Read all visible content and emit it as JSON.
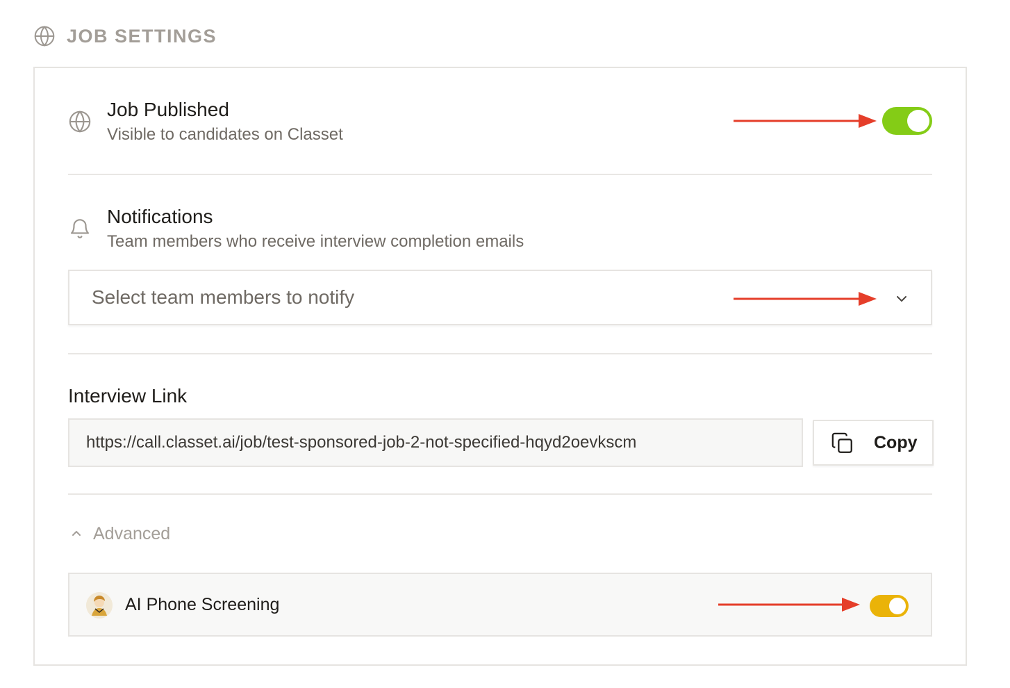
{
  "header": {
    "title": "JOB SETTINGS",
    "icon": "globe-icon"
  },
  "job_published": {
    "title": "Job Published",
    "subtitle": "Visible to candidates on Classet",
    "icon": "globe-icon",
    "toggle_on": true,
    "toggle_color": "#84cc16"
  },
  "notifications": {
    "title": "Notifications",
    "subtitle": "Team members who receive interview completion emails",
    "icon": "bell-icon",
    "select_placeholder": "Select team members to notify"
  },
  "interview_link": {
    "title": "Interview Link",
    "url": "https://call.classet.ai/job/test-sponsored-job-2-not-specified-hqyd2oevkscm",
    "copy_label": "Copy"
  },
  "advanced": {
    "label": "Advanced",
    "expanded": true,
    "ai_phone_screening": {
      "label": "AI Phone Screening",
      "toggle_on": true,
      "toggle_color": "#eab308"
    }
  },
  "annotation_color": "#e53e2a"
}
